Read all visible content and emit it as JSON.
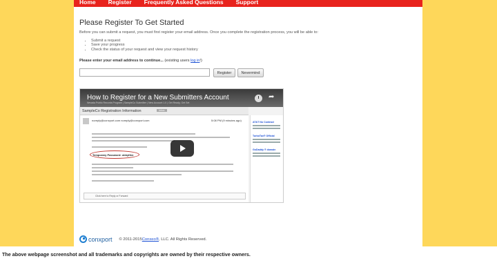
{
  "nav": {
    "items": [
      "Home",
      "Register",
      "Frequently Asked Questions",
      "Support"
    ]
  },
  "page": {
    "title": "Please Register To Get Started",
    "intro": "Before you can submit a request, you must first register your email address. Once you complete the registration process, you will be able to:",
    "bullets": [
      "Submit a request",
      "Save your progress",
      "Check the status of your request and view your request history"
    ],
    "prompt_bold": "Please enter your email address to continue...",
    "prompt_rest": " (existing users ",
    "login_link": "log in",
    "prompt_end": "!)",
    "email_value": "",
    "register_label": "Register",
    "nevermind_label": "Nevermind"
  },
  "video": {
    "title": "How to Register for a New Submitters Account",
    "subtitle": "Nevada Public Records Program | SampleCo Submitter | New Account 1.0 | Get Ready, Get Set",
    "inbox_title": "SampleCo Registration Information",
    "inbox_tag": "Inbox",
    "mail_from": "noreply@conxport.com noreply@conxport.com",
    "mail_time": "5:08 PM (9 minutes ago)",
    "temp_password": "Temporary Password: obkytfen",
    "reply_text": "Click here to Reply or Forward",
    "ads": [
      "AT&T No Contract",
      "TurboTax® Official",
      "GoDaddy ® domain"
    ]
  },
  "footer": {
    "logo_text": "conxport",
    "copyright": "© 2011-2015 ",
    "company_link": "Conxeo®",
    "copyright_end": ", LLC. All Rights Reserved."
  },
  "disclaimer": "The above webpage screenshot and all trademarks and copyrights are owned by their respective owners.",
  "colors": {
    "nav_red": "#e8231d",
    "page_yellow": "#fed75a",
    "link_blue": "#1a4fd4"
  }
}
